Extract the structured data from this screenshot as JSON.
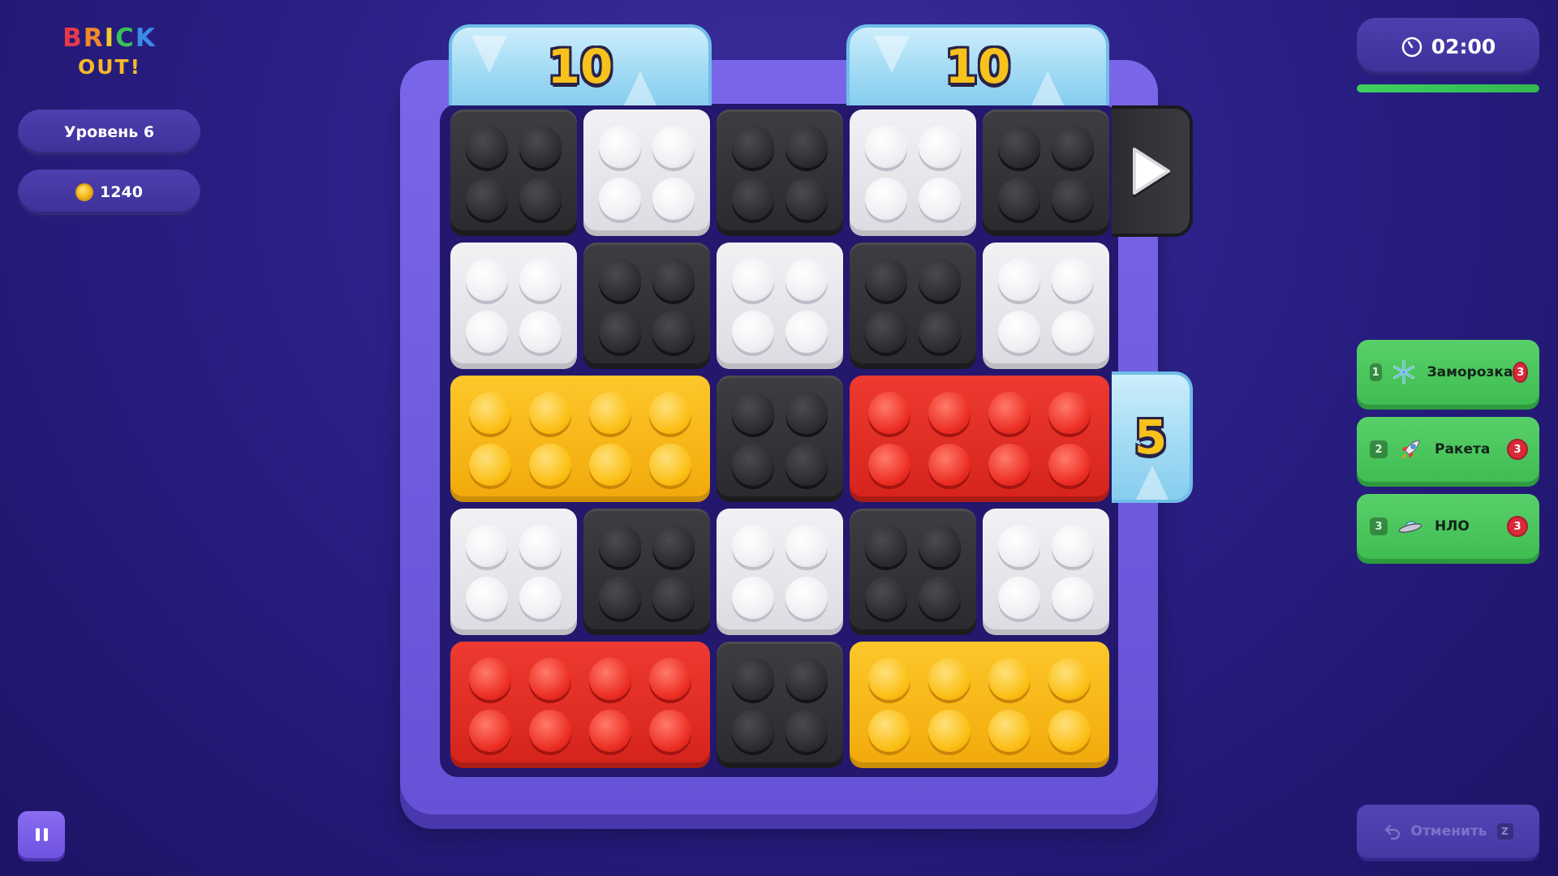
{
  "logo": {
    "line1_letters": [
      "B",
      "R",
      "I",
      "C",
      "K"
    ],
    "line2": "OUT!"
  },
  "level": {
    "label": "Уровень 6"
  },
  "coins": {
    "value": "1240",
    "icon": "coin-icon"
  },
  "timer": {
    "value": "02:00",
    "icon": "stopwatch-icon",
    "progress": 1.0,
    "bar_color": "#3ed05f"
  },
  "gates": [
    {
      "id": "gate-top-left",
      "side": "top",
      "count": "10",
      "color": "#9fd9f4"
    },
    {
      "id": "gate-top-right",
      "side": "top",
      "count": "10",
      "color": "#9fd9f4"
    },
    {
      "id": "gate-right",
      "side": "right",
      "count": "5",
      "color": "#9fd9f4"
    }
  ],
  "exit_arrow": {
    "icon": "play-arrow-icon"
  },
  "board": {
    "rows": 5,
    "cols": 5,
    "bricks": [
      {
        "row": 1,
        "col": 1,
        "width": 1,
        "color": "black"
      },
      {
        "row": 1,
        "col": 2,
        "width": 1,
        "color": "white"
      },
      {
        "row": 1,
        "col": 3,
        "width": 1,
        "color": "black"
      },
      {
        "row": 1,
        "col": 4,
        "width": 1,
        "color": "white"
      },
      {
        "row": 1,
        "col": 5,
        "width": 1,
        "color": "black"
      },
      {
        "row": 2,
        "col": 1,
        "width": 1,
        "color": "white"
      },
      {
        "row": 2,
        "col": 2,
        "width": 1,
        "color": "black"
      },
      {
        "row": 2,
        "col": 3,
        "width": 1,
        "color": "white"
      },
      {
        "row": 2,
        "col": 4,
        "width": 1,
        "color": "black"
      },
      {
        "row": 2,
        "col": 5,
        "width": 1,
        "color": "white"
      },
      {
        "row": 3,
        "col": 1,
        "width": 2,
        "color": "yellow"
      },
      {
        "row": 3,
        "col": 3,
        "width": 1,
        "color": "black"
      },
      {
        "row": 3,
        "col": 4,
        "width": 2,
        "color": "red"
      },
      {
        "row": 4,
        "col": 1,
        "width": 1,
        "color": "white"
      },
      {
        "row": 4,
        "col": 2,
        "width": 1,
        "color": "black"
      },
      {
        "row": 4,
        "col": 3,
        "width": 1,
        "color": "white"
      },
      {
        "row": 4,
        "col": 4,
        "width": 1,
        "color": "black"
      },
      {
        "row": 4,
        "col": 5,
        "width": 1,
        "color": "white"
      },
      {
        "row": 5,
        "col": 1,
        "width": 2,
        "color": "red"
      },
      {
        "row": 5,
        "col": 3,
        "width": 1,
        "color": "black"
      },
      {
        "row": 5,
        "col": 4,
        "width": 2,
        "color": "yellow"
      }
    ]
  },
  "boosters": [
    {
      "hotkey": "1",
      "icon": "snowflake-icon",
      "label": "Заморозка",
      "count": "3"
    },
    {
      "hotkey": "2",
      "icon": "rocket-icon",
      "label": "Ракета",
      "count": "3"
    },
    {
      "hotkey": "3",
      "icon": "ufo-icon",
      "label": "НЛО",
      "count": "3"
    }
  ],
  "undo": {
    "label": "Отменить",
    "hotkey": "Z",
    "icon": "undo-icon",
    "enabled": false
  },
  "pause": {
    "icon": "pause-icon"
  },
  "colors": {
    "accent": "#6f52e0",
    "booster_green": "#3fbd52",
    "badge_red": "#d92a3a",
    "gate_gold": "#f7c21c"
  }
}
